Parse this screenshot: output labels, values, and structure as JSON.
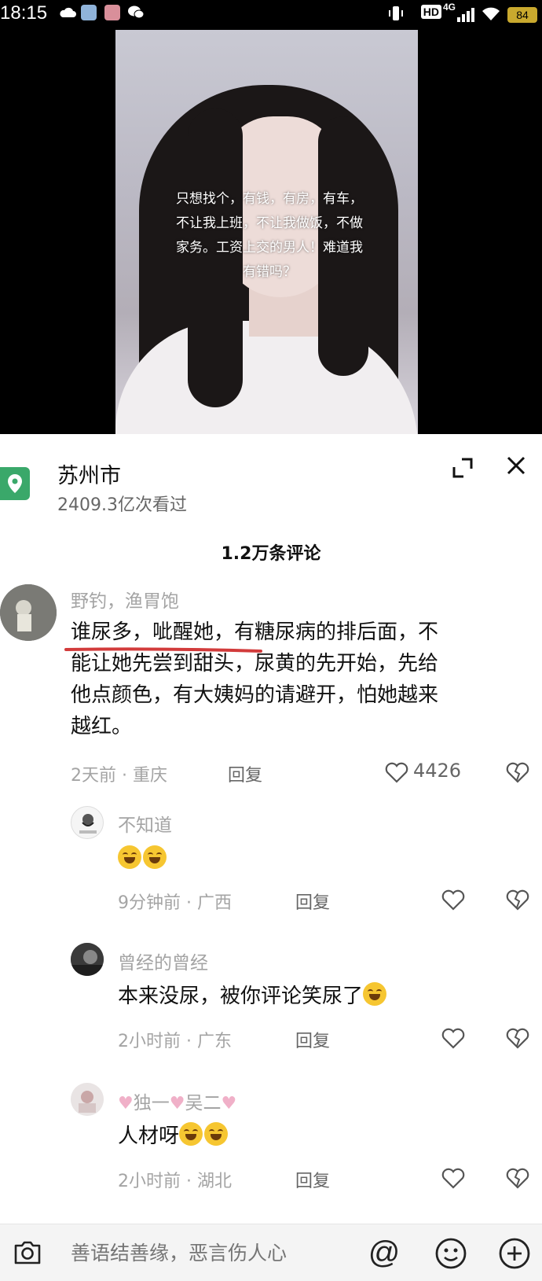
{
  "status_bar": {
    "time": "18:15",
    "network": "4G",
    "hd": "HD",
    "battery": "84"
  },
  "video": {
    "caption_lines": [
      "只想找个，有钱，有房，有车，",
      "不让我上班，不让我做饭，不做",
      "家务。工资上交的男人！难道我",
      "有错吗？"
    ]
  },
  "location": {
    "name": "苏州市",
    "views": "2409.3亿次看过"
  },
  "comments_count": "1.2万条评论",
  "comments": [
    {
      "user": "野钓，渔胃饱",
      "text_lines": [
        "谁尿多，呲醒她，有糖尿病的排后面，不",
        "能让她先尝到甜头，尿黄的先开始，先给",
        "他点颜色，有大姨妈的请避开，怕她越来",
        "越红。"
      ],
      "time": "2天前",
      "region": "重庆",
      "reply": "回复",
      "likes": "4426"
    },
    {
      "user": "不知道",
      "text": "",
      "time": "9分钟前",
      "region": "广西",
      "reply": "回复"
    },
    {
      "user": "曾经的曾经",
      "text": "本来没尿，被你评论笑尿了",
      "time": "2小时前",
      "region": "广东",
      "reply": "回复"
    },
    {
      "user": "独一",
      "user2": "吴二",
      "text": "人材呀",
      "time": "2小时前",
      "region": "湖北",
      "reply": "回复"
    }
  ],
  "bottom_bar": {
    "input_placeholder": "善语结善缘，恶言伤人心",
    "at_symbol": "@"
  },
  "colors": {
    "location_pin": "#3aa86a",
    "underline": "#d23b3b",
    "emoji": "#f6c631"
  }
}
